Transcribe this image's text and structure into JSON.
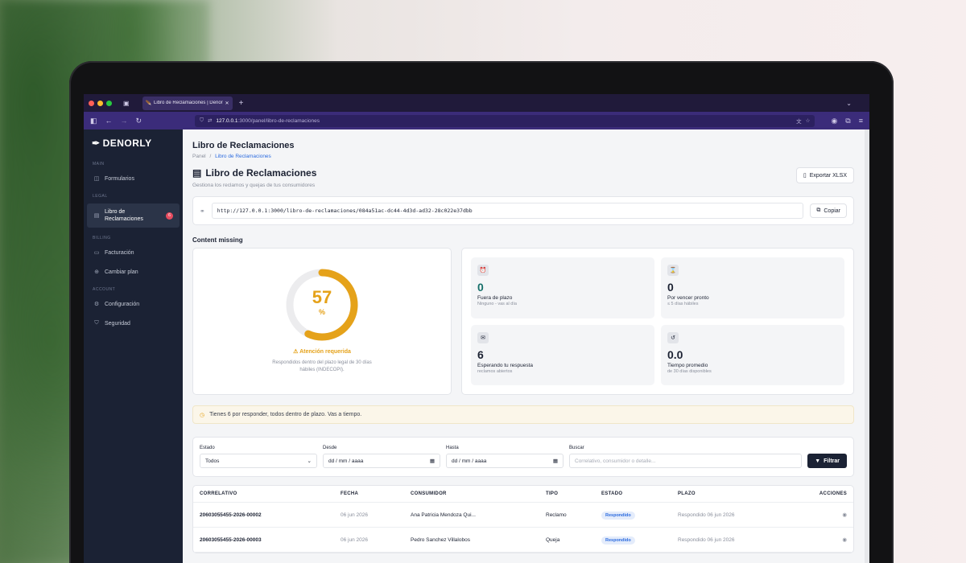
{
  "browser": {
    "tab_title": "Libro de Reclamaciones | Denorly",
    "url_host": "127.0.0.1",
    "url_rest": ":3000/panel/libro-de-reclamaciones"
  },
  "sidebar": {
    "logo": "DENORLY",
    "sections": {
      "main": "MAIN",
      "legal": "LEGAL",
      "billing": "BILLING",
      "account": "ACCOUNT"
    },
    "items": {
      "formularios": "Formularios",
      "libro": "Libro de Reclamaciones",
      "libro_badge": "6",
      "facturacion": "Facturación",
      "cambiar_plan": "Cambiar plan",
      "configuracion": "Configuración",
      "seguridad": "Seguridad"
    }
  },
  "header": {
    "title": "Libro de Reclamaciones",
    "breadcrumb_root": "Panel",
    "breadcrumb_sep": "/",
    "breadcrumb_current": "Libro de Reclamaciones"
  },
  "page": {
    "title": "Libro de Reclamaciones",
    "subtitle": "Gestiona los reclamos y quejas de tus consumidores",
    "export_label": "Exportar XLSX",
    "public_link": "http://127.0.0.1:3000/libro-de-reclamaciones/084a51ac-dc44-4d3d-ad32-28c022e37dbb",
    "copy_label": "Copiar",
    "section_title": "Content missing"
  },
  "gauge": {
    "value": "57",
    "percent_sign": "%",
    "fraction": 0.57,
    "status": "Atención requerida",
    "description": "Respondidos dentro del plazo legal de 30 días hábiles (INDECOPI).",
    "color": "#e5a21a"
  },
  "metrics": [
    {
      "icon": "alarm-icon",
      "value": "0",
      "label": "Fuera de plazo",
      "hint": "Ninguno - vas al día"
    },
    {
      "icon": "hourglass-icon",
      "value": "0",
      "label": "Por vencer pronto",
      "hint": "≤ 5 días hábiles"
    },
    {
      "icon": "inbox-icon",
      "value": "6",
      "label": "Esperando tu respuesta",
      "hint": "reclamos abiertos"
    },
    {
      "icon": "history-icon",
      "value": "0.0",
      "label": "Tiempo promedio",
      "hint": "de 30 días disponibles"
    }
  ],
  "notice": "Tienes 6 por responder, todos dentro de plazo. Vas a tiempo.",
  "filters": {
    "estado_label": "Estado",
    "estado_value": "Todos",
    "desde_label": "Desde",
    "desde_placeholder": "dd / mm / aaaa",
    "hasta_label": "Hasta",
    "hasta_placeholder": "dd / mm / aaaa",
    "buscar_label": "Buscar",
    "buscar_placeholder": "Correlativo, consumidor o detalle...",
    "filtrar_label": "Filtrar"
  },
  "table": {
    "headers": {
      "correlativo": "CORRELATIVO",
      "fecha": "FECHA",
      "consumidor": "CONSUMIDOR",
      "tipo": "TIPO",
      "estado": "ESTADO",
      "plazo": "PLAZO",
      "acciones": "ACCIONES"
    },
    "rows": [
      {
        "correlativo": "20603055455-2026-00002",
        "fecha": "06 jun 2026",
        "consumidor": "Ana Patricia Mendoza Qui...",
        "tipo": "Reclamo",
        "estado": "Respondido",
        "plazo": "Respondido 06 jun 2026"
      },
      {
        "correlativo": "20603055455-2026-00003",
        "fecha": "06 jun 2026",
        "consumidor": "Pedro Sanchez Villalobos",
        "tipo": "Queja",
        "estado": "Respondido",
        "plazo": "Respondido 06 jun 2026"
      }
    ]
  }
}
